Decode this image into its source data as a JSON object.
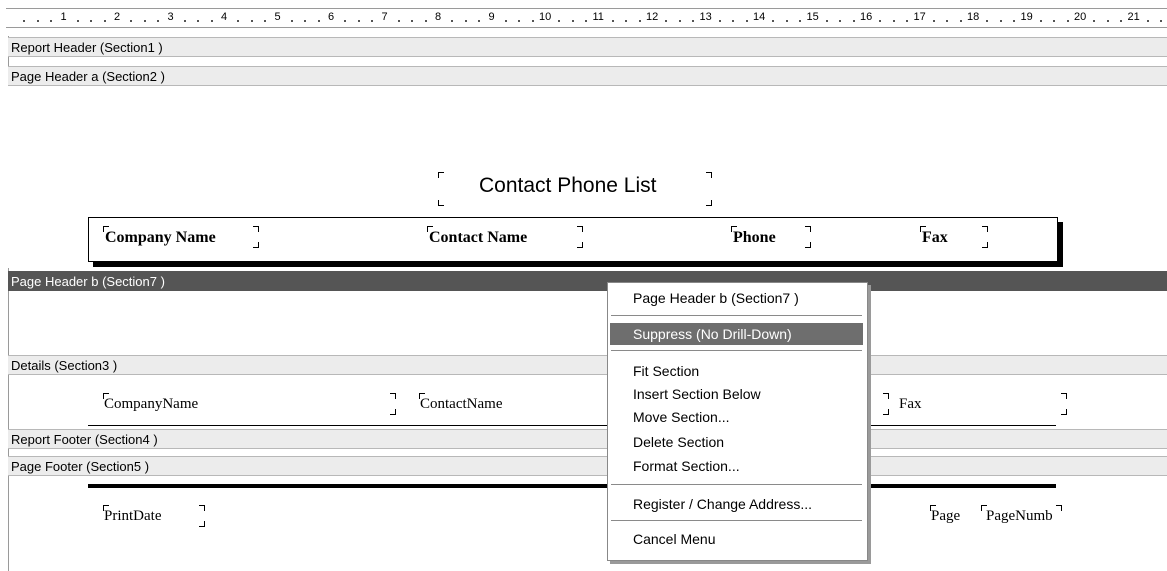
{
  "ruler": {
    "numbers": [
      "1",
      "2",
      "3",
      "4",
      "5",
      "6",
      "7",
      "8",
      "9",
      "10",
      "11",
      "12",
      "13",
      "14",
      "15",
      "16",
      "17",
      "18",
      "19",
      "20",
      "21"
    ]
  },
  "sections": {
    "report_header": "Report Header  (Section1 )",
    "page_header_a": "Page Header a (Section2 )",
    "page_header_b": "Page Header b (Section7 )",
    "details": "Details  (Section3 )",
    "report_footer": "Report Footer  (Section4 )",
    "page_footer": "Page Footer  (Section5 )"
  },
  "report": {
    "title": "Contact Phone List",
    "columns": [
      "Company Name",
      "Contact Name",
      "Phone",
      "Fax"
    ],
    "detail_fields": [
      "CompanyName",
      "ContactName",
      "Fax"
    ],
    "footer_fields": {
      "print_date": "PrintDate",
      "page_label": "Page",
      "page_number": "PageNumb"
    }
  },
  "context_menu": {
    "header": "Page Header b (Section7 )",
    "suppress": "Suppress (No Drill-Down)",
    "fit": "Fit Section",
    "insert": "Insert Section Below",
    "move": "Move Section...",
    "delete": "Delete Section",
    "format": "Format Section...",
    "register": "Register / Change Address...",
    "cancel": "Cancel Menu"
  },
  "colors": {
    "selected_band": "#555555",
    "menu_highlight": "#6e6e6e",
    "band": "#ececec"
  }
}
